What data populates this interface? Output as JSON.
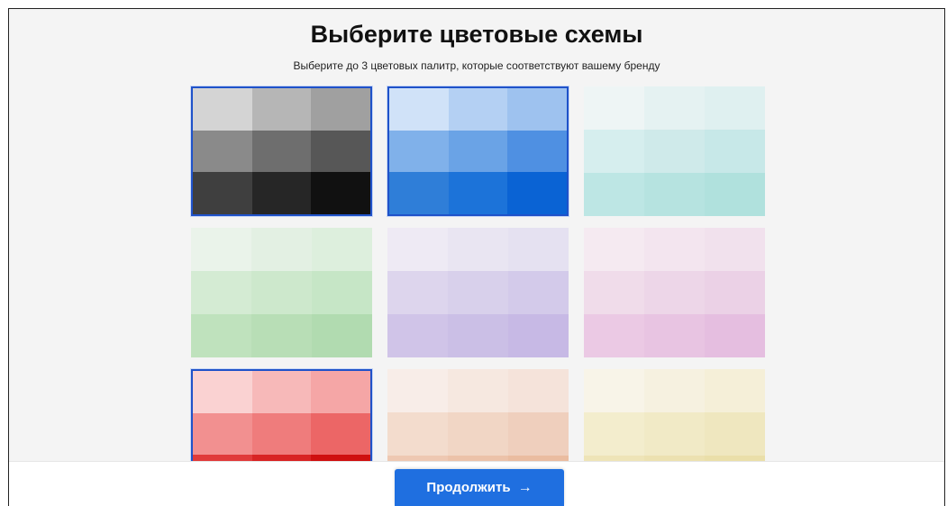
{
  "header": {
    "title": "Выберите цветовые схемы",
    "subtitle": "Выберите до 3 цветовых палитр, которые соответствуют вашему бренду"
  },
  "palettes": [
    {
      "id": "gray",
      "selected": true,
      "colors": [
        "#d4d4d4",
        "#b6b6b6",
        "#a0a0a0",
        "#8a8a8a",
        "#6e6e6e",
        "#575757",
        "#3f3f3f",
        "#262626",
        "#111111"
      ]
    },
    {
      "id": "blue",
      "selected": true,
      "colors": [
        "#d0e2f8",
        "#b4d0f3",
        "#9ec2ef",
        "#80b1ea",
        "#6aa3e6",
        "#4f90e2",
        "#2f7ed8",
        "#1c73d9",
        "#0a63d4"
      ]
    },
    {
      "id": "teal",
      "selected": false,
      "colors": [
        "#eef5f5",
        "#e5f2f2",
        "#dff0f0",
        "#d6eeee",
        "#cfeaea",
        "#c7e8e8",
        "#bde6e4",
        "#b6e3e0",
        "#b0e1dd"
      ]
    },
    {
      "id": "green",
      "selected": false,
      "colors": [
        "#eaf3ea",
        "#e3f0e3",
        "#ddefdd",
        "#d4ebd3",
        "#cde8cc",
        "#c6e6c6",
        "#bfe2bd",
        "#b8deb6",
        "#b1dbb0"
      ]
    },
    {
      "id": "purple",
      "selected": false,
      "colors": [
        "#eeeaf4",
        "#e9e5f2",
        "#e5e1f1",
        "#ddd5ed",
        "#d8d0eb",
        "#d3caea",
        "#d0c4e8",
        "#cbbfe6",
        "#c7b9e5"
      ]
    },
    {
      "id": "pink",
      "selected": false,
      "colors": [
        "#f5eaf1",
        "#f3e5ef",
        "#f1e1ed",
        "#f0dcea",
        "#edd6e8",
        "#ebd1e6",
        "#ebc9e4",
        "#e8c4e2",
        "#e5bee0"
      ]
    },
    {
      "id": "red",
      "selected": true,
      "colors": [
        "#fad2d2",
        "#f7b9b9",
        "#f5a6a6",
        "#f29090",
        "#ef7c7c",
        "#ec6666",
        "#e03a3a",
        "#d82424",
        "#cf1010"
      ]
    },
    {
      "id": "peach",
      "selected": false,
      "colors": [
        "#f8ede8",
        "#f6e8e0",
        "#f5e3da",
        "#f3dccd",
        "#f1d6c5",
        "#efcfbd",
        "#eec8b2",
        "#ecc2a9",
        "#eabca0"
      ]
    },
    {
      "id": "yellow",
      "selected": false,
      "colors": [
        "#f8f4e8",
        "#f6f1e0",
        "#f5efd8",
        "#f3edcd",
        "#f1eac6",
        "#efe7bf",
        "#eee4b7",
        "#ece1b0",
        "#eadfa9"
      ]
    }
  ],
  "footer": {
    "continue_label": "Продолжить",
    "arrow_glyph": "→"
  }
}
